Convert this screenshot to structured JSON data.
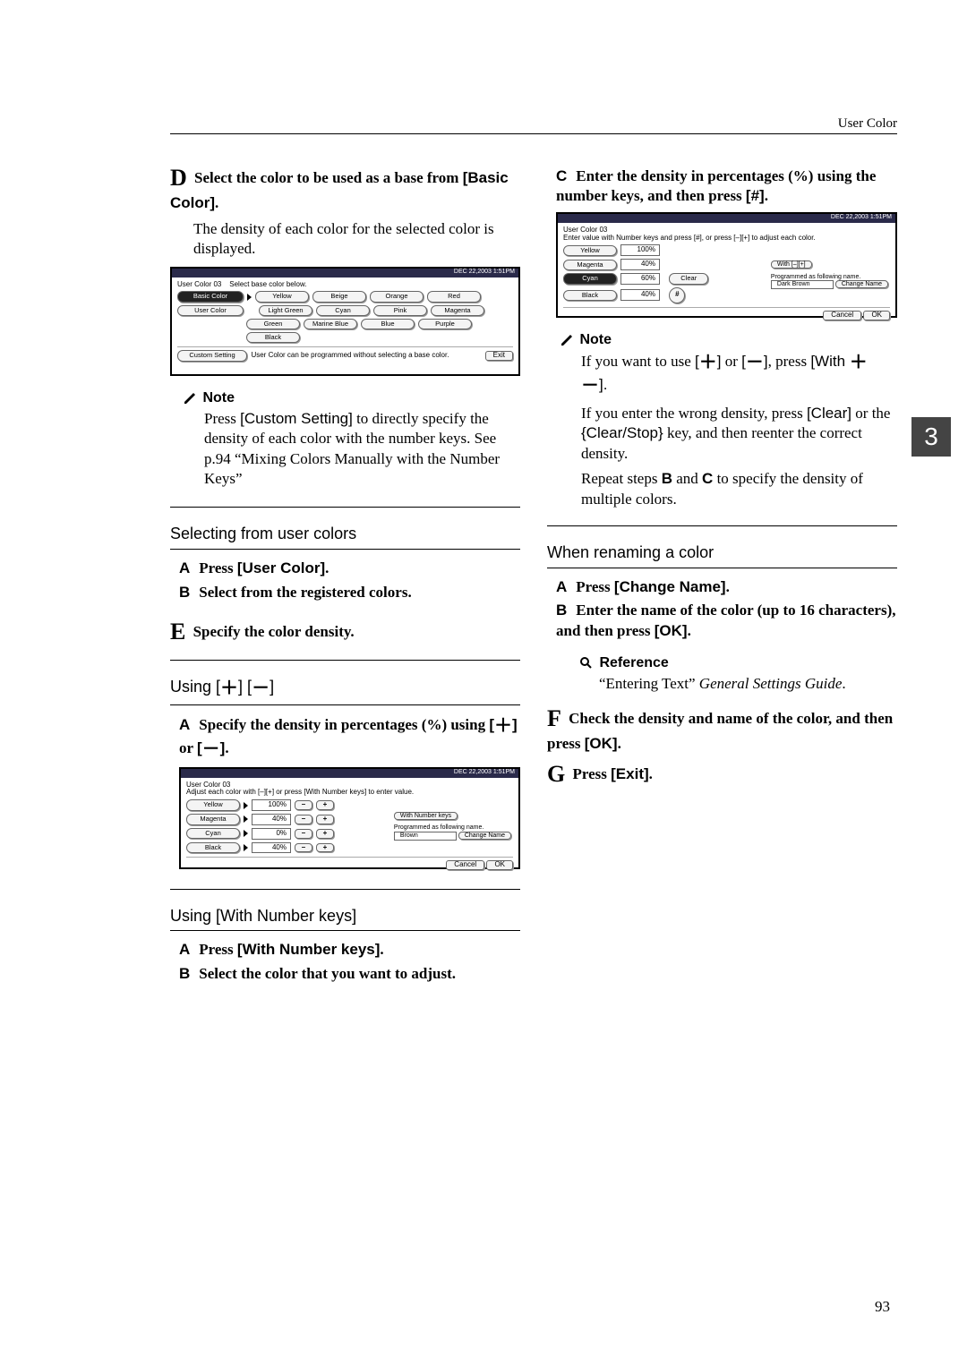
{
  "header": {
    "section": "User Color",
    "page_number": "93",
    "side_tab": "3"
  },
  "left": {
    "stepD": {
      "letter": "D",
      "lead_a": "Select the color to be used as a base from ",
      "ui": "[Basic Color]",
      "lead_b": ".",
      "body": "The density of each color for the selected color is displayed."
    },
    "note1": {
      "title": "Note",
      "body_a": "Press ",
      "ui": "[Custom Setting]",
      "body_b": " to directly specify the density of each color with the number keys. See p.94 “Mixing Colors Manually with the Number Keys”"
    },
    "sec_select": {
      "title": "Selecting from user colors",
      "a_lbl": "A",
      "a_txt_a": "Press ",
      "a_ui": "[User Color]",
      "a_txt_b": ".",
      "b_lbl": "B",
      "b_txt": "Select from the registered colors."
    },
    "stepE": {
      "letter": "E",
      "text": "Specify the color density."
    },
    "sec_pm": {
      "title_a": "Using ",
      "title_b": "[",
      "title_c": "] [",
      "title_d": "]",
      "a_lbl": "A",
      "a_txt_a": "Specify the density in percentages (%) using ",
      "a_txt_b": " or ",
      "a_txt_c": "."
    },
    "sec_num": {
      "title_a": "Using ",
      "title_ui": "[With Number keys]",
      "a_lbl": "A",
      "a_txt_a": "Press ",
      "a_ui": "[With Number keys]",
      "a_txt_b": ".",
      "b_lbl": "B",
      "b_txt": "Select the color that you want to adjust."
    }
  },
  "right": {
    "stepC_cont": {
      "lbl": "C",
      "txt_a": "Enter the density in percentages (%) using the number keys, and then press ",
      "ui": "[#]",
      "txt_b": "."
    },
    "note2": {
      "title": "Note",
      "p1_a": "If you want to use ",
      "p1_b": " or ",
      "p1_c": ", press ",
      "p1_ui": "[With ",
      "p1_d": "].",
      "p2_a": "If you enter the wrong density, press ",
      "p2_ui1": "[Clear]",
      "p2_b": " or the ",
      "p2_ui2": "{Clear/Stop}",
      "p2_c": " key, and then reenter the correct density.",
      "p3_a": "Repeat steps ",
      "p3_b": " and ",
      "p3_c": " to specify the density of multiple colors.",
      "lblB": "B",
      "lblC": "C"
    },
    "sec_rename": {
      "title": "When renaming a color",
      "a_lbl": "A",
      "a_txt_a": "Press ",
      "a_ui": "[Change Name]",
      "a_txt_b": ".",
      "b_lbl": "B",
      "b_txt_a": "Enter the name of the color (up to 16 characters), and then press ",
      "b_ui": "[OK]",
      "b_txt_b": "."
    },
    "ref": {
      "title": "Reference",
      "body": "“Entering Text” General Settings Guide."
    },
    "stepF": {
      "letter": "F",
      "txt_a": "Check the density and name of the color, and then press ",
      "ui": "[OK]",
      "txt_b": "."
    },
    "stepG": {
      "letter": "G",
      "txt_a": "Press ",
      "ui": "[Exit]",
      "txt_b": "."
    }
  },
  "shot1": {
    "bar": "DEC   22,2003   1:51PM",
    "title": "User Color 03",
    "hint": "Select base color below.",
    "tabs": {
      "basic": "Basic Color",
      "user": "User Color"
    },
    "grid": [
      "Yellow",
      "Beige",
      "Orange",
      "Red",
      "Light Green",
      "Cyan",
      "Pink",
      "Magenta",
      "Green",
      "Marine Blue",
      "Blue",
      "Purple",
      "Black"
    ],
    "custom": "Custom Setting",
    "custom_note": "User Color can be programmed without selecting a base color.",
    "exit": "Exit"
  },
  "shot2": {
    "bar": "DEC   22,2003   1:51PM",
    "title": "User Color 03",
    "hint": "Adjust each color with [–][+] or press [With Number keys] to enter value.",
    "rows": [
      {
        "name": "Yellow",
        "val": "100%"
      },
      {
        "name": "Magenta",
        "val": "40%"
      },
      {
        "name": "Cyan",
        "val": "0%"
      },
      {
        "name": "Black",
        "val": "40%"
      }
    ],
    "withnum": "With Number keys",
    "reg_label": "Programmed as following name.",
    "reg_name": "Brown",
    "change": "Change Name",
    "cancel": "Cancel",
    "ok": "OK"
  },
  "shot3": {
    "bar": "DEC   22,2003   1:51PM",
    "title": "User Color 03",
    "hint": "Enter value with Number keys and press [#], or press [–][+] to adjust each color.",
    "rows": [
      {
        "name": "Yellow",
        "val": "100%"
      },
      {
        "name": "Magenta",
        "val": "40%"
      },
      {
        "name": "Cyan",
        "val": "60%"
      },
      {
        "name": "Black",
        "val": "40%"
      }
    ],
    "withpm": "With [–][+]",
    "clear": "Clear",
    "reg_label": "Programmed as following name.",
    "reg_name": "Dark Brown",
    "change": "Change Name",
    "cancel": "Cancel",
    "ok": "OK"
  }
}
